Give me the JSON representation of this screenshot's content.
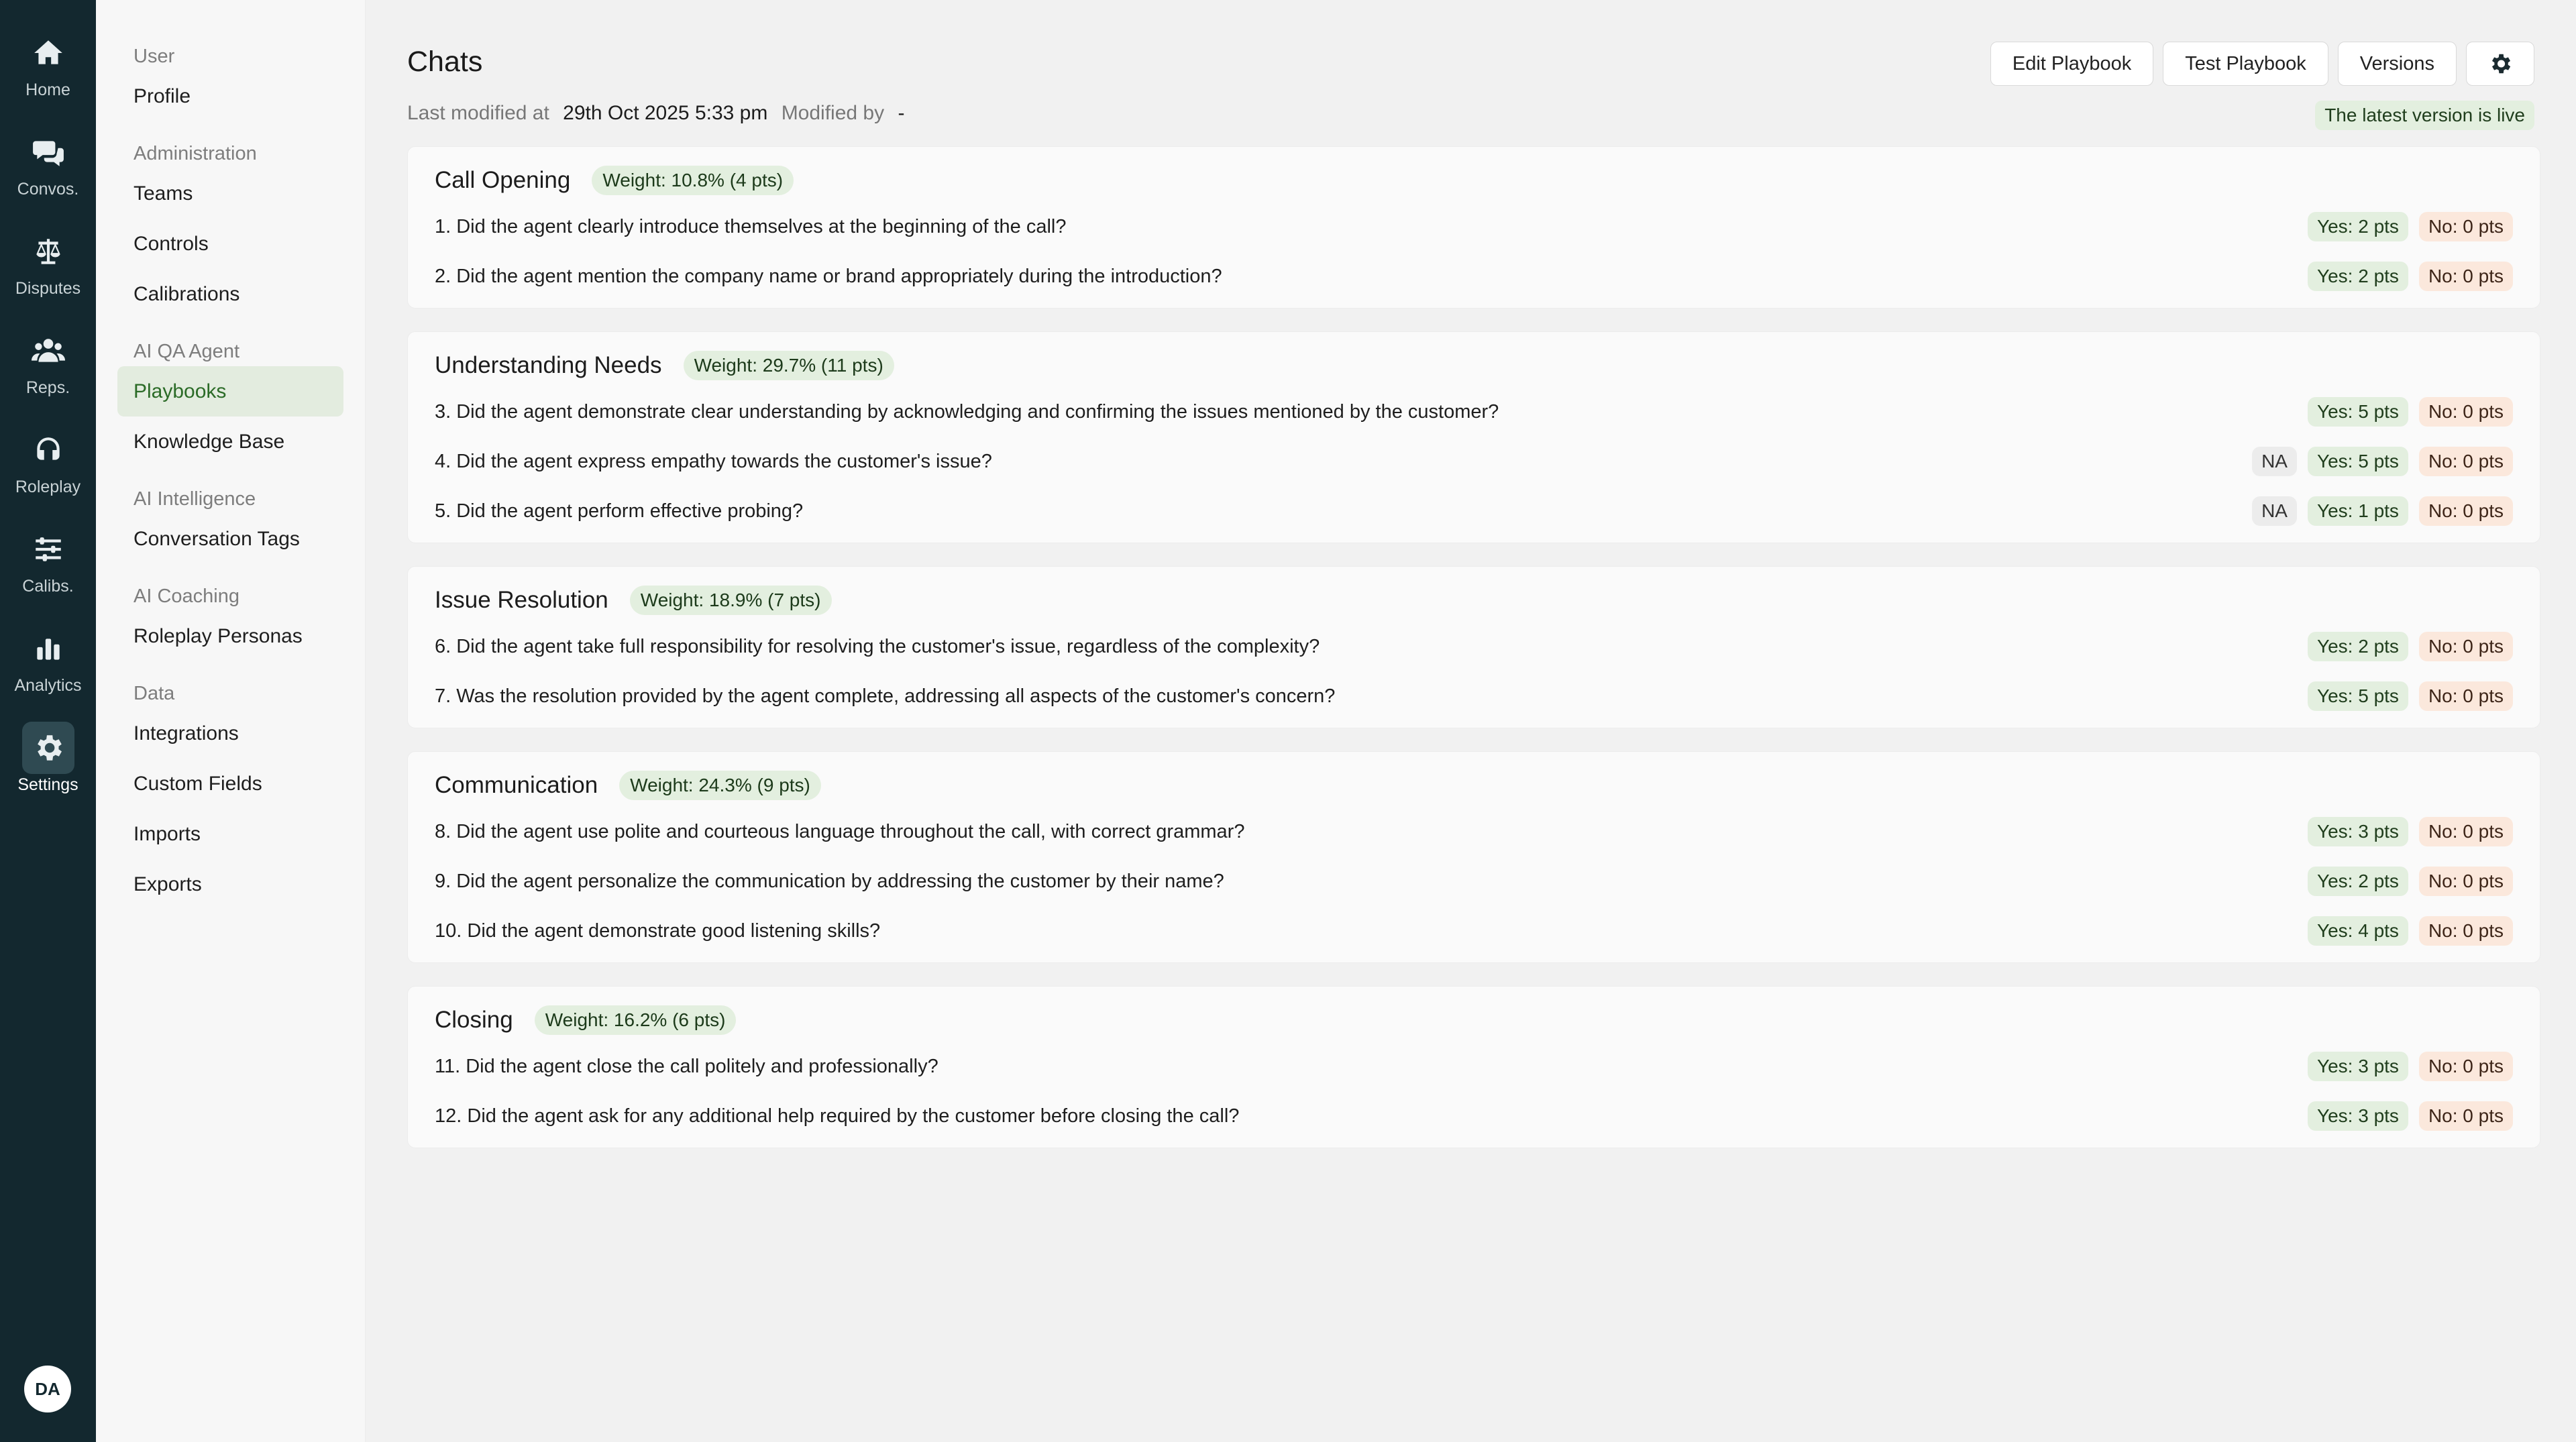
{
  "rail": [
    {
      "label": "Home",
      "icon": "home-icon"
    },
    {
      "label": "Convos.",
      "icon": "chat-bubbles-icon"
    },
    {
      "label": "Disputes",
      "icon": "scales-icon"
    },
    {
      "label": "Reps.",
      "icon": "users-icon"
    },
    {
      "label": "Roleplay",
      "icon": "headset-icon"
    },
    {
      "label": "Calibs.",
      "icon": "sliders-icon"
    },
    {
      "label": "Analytics",
      "icon": "bar-chart-icon"
    },
    {
      "label": "Settings",
      "icon": "gear-icon"
    }
  ],
  "user_initials": "DA",
  "sidebar": [
    {
      "head": "User",
      "items": [
        {
          "label": "Profile"
        }
      ]
    },
    {
      "head": "Administration",
      "items": [
        {
          "label": "Teams"
        },
        {
          "label": "Controls"
        },
        {
          "label": "Calibrations"
        }
      ]
    },
    {
      "head": "AI QA Agent",
      "items": [
        {
          "label": "Playbooks"
        },
        {
          "label": "Knowledge Base"
        }
      ]
    },
    {
      "head": "AI Intelligence",
      "items": [
        {
          "label": "Conversation Tags"
        }
      ]
    },
    {
      "head": "AI Coaching",
      "items": [
        {
          "label": "Roleplay Personas"
        }
      ]
    },
    {
      "head": "Data",
      "items": [
        {
          "label": "Integrations"
        },
        {
          "label": "Custom Fields"
        },
        {
          "label": "Imports"
        },
        {
          "label": "Exports"
        }
      ]
    }
  ],
  "header": {
    "title": "Chats",
    "modified_label": "Last modified at",
    "modified_value": "29th Oct 2025 5:33 pm",
    "modified_by_label": "Modified by",
    "modified_by_value": "-",
    "live_badge": "The latest version is live",
    "buttons": {
      "edit": "Edit Playbook",
      "test": "Test Playbook",
      "versions": "Versions"
    }
  },
  "sections": [
    {
      "title": "Call Opening",
      "weight": "Weight: 10.8% (4 pts)",
      "questions": [
        {
          "text": "1. Did the agent clearly introduce themselves at the beginning of the call?",
          "na": "",
          "yes": "Yes: 2 pts",
          "no": "No: 0 pts"
        },
        {
          "text": "2. Did the agent mention the company name or brand appropriately during the introduction?",
          "na": "",
          "yes": "Yes: 2 pts",
          "no": "No: 0 pts"
        }
      ]
    },
    {
      "title": "Understanding Needs",
      "weight": "Weight: 29.7% (11 pts)",
      "questions": [
        {
          "text": "3. Did the agent demonstrate clear understanding by acknowledging and confirming the issues mentioned by the customer?",
          "na": "",
          "yes": "Yes: 5 pts",
          "no": "No: 0 pts"
        },
        {
          "text": "4. Did the agent express empathy towards the customer's issue?",
          "na": "NA",
          "yes": "Yes: 5 pts",
          "no": "No: 0 pts"
        },
        {
          "text": "5. Did the agent perform effective probing?",
          "na": "NA",
          "yes": "Yes: 1 pts",
          "no": "No: 0 pts"
        }
      ]
    },
    {
      "title": "Issue Resolution",
      "weight": "Weight: 18.9% (7 pts)",
      "questions": [
        {
          "text": "6. Did the agent take full responsibility for resolving the customer's issue, regardless of the complexity?",
          "na": "",
          "yes": "Yes: 2 pts",
          "no": "No: 0 pts"
        },
        {
          "text": "7. Was the resolution provided by the agent complete, addressing all aspects of the customer's concern?",
          "na": "",
          "yes": "Yes: 5 pts",
          "no": "No: 0 pts"
        }
      ]
    },
    {
      "title": "Communication",
      "weight": "Weight: 24.3% (9 pts)",
      "questions": [
        {
          "text": "8. Did the agent use polite and courteous language throughout the call, with correct grammar?",
          "na": "",
          "yes": "Yes: 3 pts",
          "no": "No: 0 pts"
        },
        {
          "text": "9. Did the agent personalize the communication by addressing the customer by their name?",
          "na": "",
          "yes": "Yes: 2 pts",
          "no": "No: 0 pts"
        },
        {
          "text": "10. Did the agent demonstrate good listening skills?",
          "na": "",
          "yes": "Yes: 4 pts",
          "no": "No: 0 pts"
        }
      ]
    },
    {
      "title": "Closing",
      "weight": "Weight: 16.2% (6 pts)",
      "questions": [
        {
          "text": "11. Did the agent close the call politely and professionally?",
          "na": "",
          "yes": "Yes: 3 pts",
          "no": "No: 0 pts"
        },
        {
          "text": "12. Did the agent ask for any additional help required by the customer before closing the call?",
          "na": "",
          "yes": "Yes: 3 pts",
          "no": "No: 0 pts"
        }
      ]
    }
  ]
}
